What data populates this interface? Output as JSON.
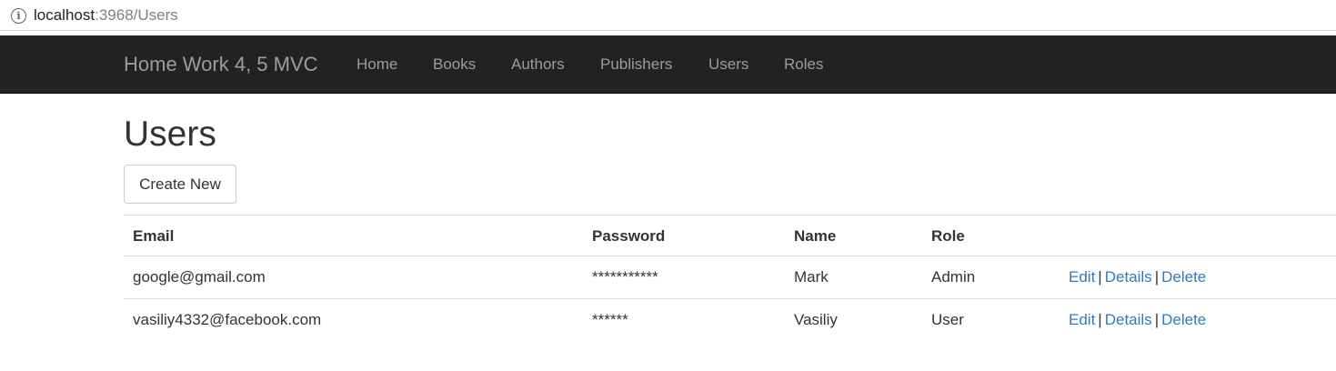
{
  "browser": {
    "url_host": "localhost",
    "url_rest": ":3968/Users",
    "info_icon": "info-icon"
  },
  "navbar": {
    "brand": "Home Work 4, 5 MVC",
    "items": [
      {
        "label": "Home"
      },
      {
        "label": "Books"
      },
      {
        "label": "Authors"
      },
      {
        "label": "Publishers"
      },
      {
        "label": "Users"
      },
      {
        "label": "Roles"
      }
    ]
  },
  "main": {
    "title": "Users",
    "create_label": "Create New"
  },
  "table": {
    "headers": {
      "email": "Email",
      "password": "Password",
      "name": "Name",
      "role": "Role"
    },
    "rows": [
      {
        "email": "google@gmail.com",
        "password": "***********",
        "name": "Mark",
        "role": "Admin"
      },
      {
        "email": "vasiliy4332@facebook.com",
        "password": "******",
        "name": "Vasiliy",
        "role": "User"
      }
    ],
    "actions": {
      "edit": "Edit",
      "details": "Details",
      "delete": "Delete",
      "separator": "|"
    }
  },
  "colors": {
    "navbar_bg": "#222222",
    "nav_text": "#9d9d9d",
    "link": "#337ab7"
  }
}
